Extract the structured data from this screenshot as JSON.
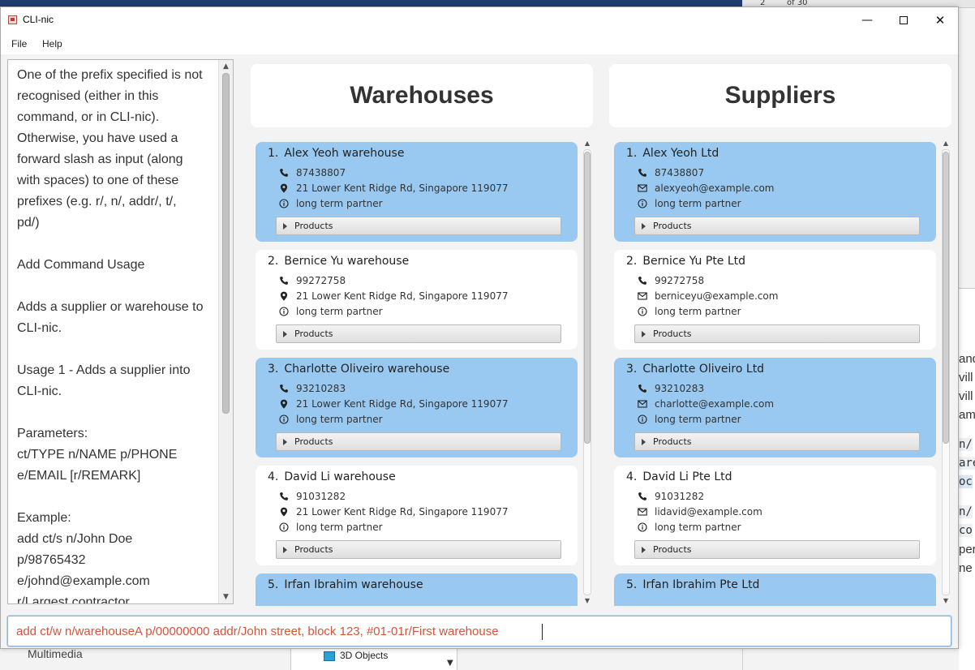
{
  "background": {
    "top_right": {
      "page": "2",
      "of": "of 30"
    },
    "bottom_left_label": "Multimedia",
    "tree_item": "3D Objects",
    "doc_fragments": [
      {
        "text": "and",
        "mono": false,
        "hl": false
      },
      {
        "text": "vill c",
        "mono": false,
        "hl": false
      },
      {
        "text": "vill c",
        "mono": false,
        "hl": false
      },
      {
        "text": "am",
        "mono": false,
        "hl": false
      },
      {
        "text": "n/",
        "mono": true,
        "hl": false
      },
      {
        "text": "are",
        "mono": true,
        "hl": false
      },
      {
        "text": "oc",
        "mono": true,
        "hl": true
      },
      {
        "text": "n/",
        "mono": true,
        "hl": false
      },
      {
        "text": "co",
        "mono": true,
        "hl": false
      },
      {
        "text": "per",
        "mono": false,
        "hl": false
      },
      {
        "text": "ne",
        "mono": false,
        "hl": false
      }
    ]
  },
  "window": {
    "title": "CLI-nic",
    "controls": {
      "minimize": "—",
      "close": "✕"
    }
  },
  "menu": {
    "file": "File",
    "help": "Help"
  },
  "result": {
    "lines": [
      "One of the prefix specified is not",
      "recognised (either in this",
      "command, or in CLI-nic).",
      "Otherwise, you have used a",
      "forward slash as input (along",
      "with spaces) to one of these",
      "prefixes (e.g. r/, n/, addr/, t/,",
      "pd/)",
      "",
      "Add Command Usage",
      "",
      "Adds a supplier or warehouse to",
      "CLI-nic.",
      "",
      "Usage 1 - Adds a supplier into",
      "CLI-nic.",
      "",
      "Parameters:",
      "ct/TYPE n/NAME p/PHONE",
      "e/EMAIL [r/REMARK]",
      "",
      "Example:",
      "add ct/s n/John Doe",
      "p/98765432",
      "e/johnd@example.com",
      "r/Largest contractor"
    ]
  },
  "warehouses": {
    "header": "Warehouses",
    "products_label": "Products",
    "items": [
      {
        "index": "1.",
        "name": "Alex Yeoh warehouse",
        "phone": "87438807",
        "address": "21 Lower Kent Ridge Rd, Singapore 119077",
        "remark": "long term partner",
        "highlight": true
      },
      {
        "index": "2.",
        "name": "Bernice Yu warehouse",
        "phone": "99272758",
        "address": "21 Lower Kent Ridge Rd, Singapore 119077",
        "remark": "long term partner",
        "highlight": false
      },
      {
        "index": "3.",
        "name": "Charlotte Oliveiro warehouse",
        "phone": "93210283",
        "address": "21 Lower Kent Ridge Rd, Singapore 119077",
        "remark": "long term partner",
        "highlight": true
      },
      {
        "index": "4.",
        "name": "David Li warehouse",
        "phone": "91031282",
        "address": "21 Lower Kent Ridge Rd, Singapore 119077",
        "remark": "long term partner",
        "highlight": false
      },
      {
        "index": "5.",
        "name": "Irfan Ibrahim warehouse",
        "phone": "",
        "address": "",
        "remark": "",
        "highlight": true
      }
    ]
  },
  "suppliers": {
    "header": "Suppliers",
    "products_label": "Products",
    "items": [
      {
        "index": "1.",
        "name": "Alex Yeoh Ltd",
        "phone": "87438807",
        "email": "alexyeoh@example.com",
        "remark": "long term partner",
        "highlight": true
      },
      {
        "index": "2.",
        "name": "Bernice Yu Pte Ltd",
        "phone": "99272758",
        "email": "berniceyu@example.com",
        "remark": "long term partner",
        "highlight": false
      },
      {
        "index": "3.",
        "name": "Charlotte Oliveiro Ltd",
        "phone": "93210283",
        "email": "charlotte@example.com",
        "remark": "long term partner",
        "highlight": true
      },
      {
        "index": "4.",
        "name": "David Li Pte Ltd",
        "phone": "91031282",
        "email": "lidavid@example.com",
        "remark": "long term partner",
        "highlight": false
      },
      {
        "index": "5.",
        "name": "Irfan Ibrahim Pte Ltd",
        "phone": "",
        "email": "",
        "remark": "",
        "highlight": true
      }
    ]
  },
  "command": {
    "value": "add ct/w n/warehouseA p/00000000 addr/John street, block 123, #01-01r/First warehouse"
  },
  "colors": {
    "card_highlight": "#99c9f0",
    "command_text": "#d5533b"
  }
}
